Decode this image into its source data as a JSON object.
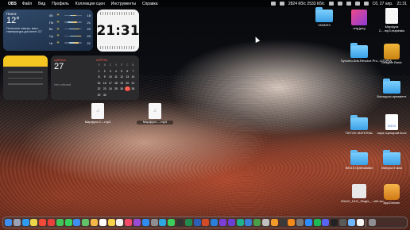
{
  "menubar": {
    "app_name": "OBS",
    "items": [
      "Файл",
      "Вид",
      "Профиль",
      "Коллекция сцен",
      "Инструменты",
      "Справка"
    ],
    "network_status": "2824 Кб/с 2533 Кб/с",
    "date": "Сб, 27 апр.",
    "time": "21:31"
  },
  "weather": {
    "city": "Пинск",
    "temperature": "12°",
    "description": "Потеплеет завтра, макс. температура достигнет 21°",
    "forecast": [
      {
        "time": "05",
        "temp": "18",
        "icon": "sun-icon"
      },
      {
        "time": "Пн",
        "temp": "21",
        "icon": "sun-icon"
      },
      {
        "time": "Вт",
        "temp": "22",
        "icon": "sun-icon"
      },
      {
        "time": "Ср",
        "temp": "23",
        "icon": "sun-icon"
      },
      {
        "time": "Чт",
        "temp": "21",
        "icon": "sun-icon"
      }
    ]
  },
  "clock": {
    "time": "21:31"
  },
  "calendar": {
    "weekday": "суббота",
    "day": "27",
    "no_events": "Нет событий",
    "month": "АПРЕЛЬ",
    "week_header": [
      "П",
      "В",
      "С",
      "Ч",
      "П",
      "С",
      "В"
    ],
    "days": [
      "1",
      "2",
      "3",
      "4",
      "5",
      "6",
      "7",
      "8",
      "9",
      "10",
      "11",
      "12",
      "13",
      "14",
      "15",
      "16",
      "17",
      "18",
      "19",
      "20",
      "21",
      "22",
      "23",
      "24",
      "25",
      "26",
      "27",
      "28",
      "29",
      "30"
    ],
    "today": "27"
  },
  "desktop": {
    "left_icons": [
      {
        "label": "Марфуга 2-...mp3",
        "type": "audio"
      },
      {
        "label": "Марфуга -...mp3",
        "type": "audio"
      }
    ],
    "right_icons": [
      {
        "label": "YANDEX",
        "type": "folder"
      },
      {
        "label": "orig.jpeg",
        "type": "image"
      },
      {
        "label": "Марфуга 2-...mp3.reapeaks",
        "type": "document"
      },
      {
        "label": "Synchro.Arts.Revoice.Pro...UTOPIA",
        "type": "folder"
      },
      {
        "label": "Seagate Basic",
        "type": "drive"
      },
      {
        "label": "Беларускі арнамент",
        "type": "folder"
      },
      {
        "label": "TIKTOK MATERIAL",
        "type": "folder"
      },
      {
        "label": "лира сценарий.docx",
        "type": "docx"
      },
      {
        "label": "Win10 Optimization",
        "type": "folder"
      },
      {
        "label": "Минуса 9 мая",
        "type": "folder"
      },
      {
        "label": "Win10_1511_Single_...x64.iso",
        "type": "disk-image"
      },
      {
        "label": "AppCleaner",
        "type": "app"
      }
    ]
  },
  "dock": {
    "apps": [
      "finder",
      "launchpad",
      "safari",
      "chrome",
      "yandex",
      "opera",
      "facetime",
      "messages",
      "mail",
      "maps",
      "photos",
      "calendar",
      "notes",
      "reminders",
      "music",
      "podcasts",
      "appstore",
      "settings",
      "telegram",
      "whatsapp",
      "obs",
      "excel",
      "word",
      "powerpoint",
      "photoshop",
      "premiere",
      "aftereffects",
      "audition",
      "lightroom",
      "reaper",
      "logic",
      "garageband",
      "finalcut",
      "vlc",
      "transmission",
      "zoom",
      "spotify",
      "discord",
      "terminal",
      "activity",
      "preview",
      "textedit",
      "trash"
    ],
    "colors": [
      "#3d8ef0",
      "#9aa3b5",
      "#2e9bf0",
      "#e9d64a",
      "#f04a3a",
      "#e8403a",
      "#41c55a",
      "#38d15c",
      "#3e8ff0",
      "#61c26a",
      "#f2b84a",
      "#ffffff",
      "#f5d24b",
      "#f0f0f0",
      "#f24a6a",
      "#9a4bd6",
      "#2f8cf2",
      "#8e8e93",
      "#2ea6df",
      "#3ccf5c",
      "#333333",
      "#1f8b4c",
      "#2b5fb8",
      "#d44b2a",
      "#2b7fd8",
      "#7b3fd6",
      "#6a3fd6",
      "#1fb08a",
      "#3a7fd6",
      "#4a9e4a",
      "#c0c0c0",
      "#f29b2a",
      "#3a3a3a",
      "#f08a1a",
      "#7a7a7a",
      "#2d8cff",
      "#1db954",
      "#5865f2",
      "#222222",
      "#5a5a5a",
      "#6fb8ff",
      "#f5f5f5",
      "#8e8e93"
    ]
  }
}
